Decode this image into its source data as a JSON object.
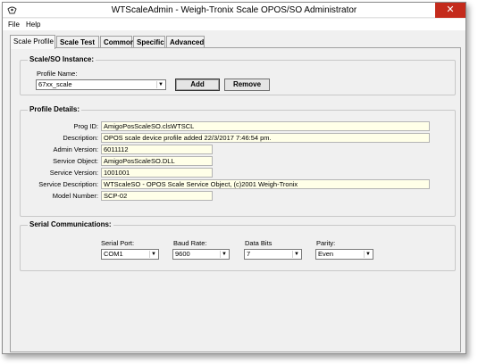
{
  "window": {
    "title": "WTScaleAdmin - Weigh-Tronix Scale OPOS/SO Administrator",
    "close_glyph": "✕"
  },
  "menu": {
    "file": "File",
    "help": "Help"
  },
  "tabs": [
    "Scale Profile",
    "Scale Test",
    "Common",
    "Specific",
    "Advanced"
  ],
  "instance": {
    "title": "Scale/SO Instance:",
    "profile_label": "Profile Name:",
    "profile_value": "67xx_scale",
    "add_label": "Add",
    "remove_label": "Remove"
  },
  "profile": {
    "title": "Profile Details:",
    "prog_id_label": "Prog ID:",
    "prog_id": "AmigoPosScaleSO.clsWTSCL",
    "description_label": "Description:",
    "description": "OPOS scale device profile added 22/3/2017 7:46:54 pm.",
    "admin_version_label": "Admin Version:",
    "admin_version": "6011112",
    "service_object_label": "Service Object:",
    "service_object": "AmigoPosScaleSO.DLL",
    "service_version_label": "Service Version:",
    "service_version": "1001001",
    "service_description_label": "Service Description:",
    "service_description": "WTScaleSO - OPOS Scale Service Object, (c)2001 Weigh-Tronix",
    "model_number_label": "Model Number:",
    "model_number": "SCP-02"
  },
  "serial": {
    "title": "Serial Communications:",
    "port_label": "Serial Port:",
    "port": "COM1",
    "baud_label": "Baud Rate:",
    "baud": "9600",
    "databits_label": "Data Bits",
    "databits": "7",
    "parity_label": "Parity:",
    "parity": "Even"
  },
  "colors": {
    "field_bg": "#ffffe8",
    "close_red": "#c42b1c"
  }
}
